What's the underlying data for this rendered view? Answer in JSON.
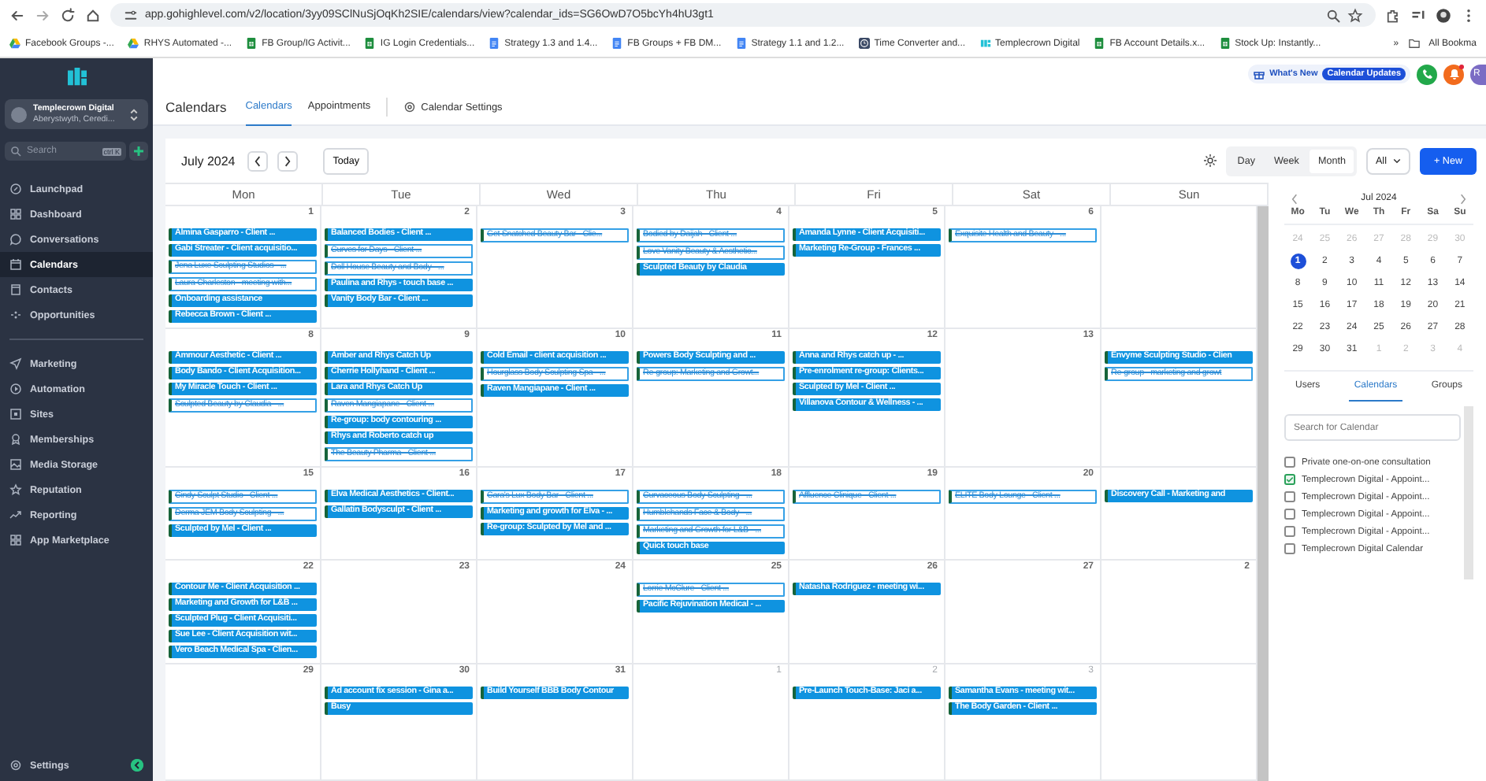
{
  "browser": {
    "url": "app.gohighlevel.com/v2/location/3yy09SClNuSjOqKh2SIE/calendars/view?calendar_ids=SG6OwD7O5bcYh4hU3gt1",
    "bookmarks": [
      {
        "label": "Facebook Groups -...",
        "kind": "drive"
      },
      {
        "label": "RHYS Automated -...",
        "kind": "drive"
      },
      {
        "label": "FB Group/IG Activit...",
        "kind": "sheets"
      },
      {
        "label": "IG Login Credentials...",
        "kind": "sheets"
      },
      {
        "label": "Strategy 1.3 and 1.4...",
        "kind": "docs"
      },
      {
        "label": "FB Groups + FB DM...",
        "kind": "docs"
      },
      {
        "label": "Strategy 1.1 and 1.2...",
        "kind": "docs"
      },
      {
        "label": "Time Converter and...",
        "kind": "clock"
      },
      {
        "label": "Templecrown Digital",
        "kind": "brand"
      },
      {
        "label": "FB Account Details.x...",
        "kind": "sheets"
      },
      {
        "label": "Stock Up: Instantly...",
        "kind": "sheets"
      }
    ],
    "more": "»",
    "all_bookmarks": "All Bookma"
  },
  "sidebar": {
    "account": {
      "name": "Templecrown Digital",
      "location": "Aberystwyth, Ceredi..."
    },
    "search": {
      "placeholder": "Search",
      "shortcut": "ctrl K"
    },
    "groups": [
      [
        {
          "label": "Launchpad",
          "selected": false
        },
        {
          "label": "Dashboard",
          "selected": false
        },
        {
          "label": "Conversations",
          "selected": false
        },
        {
          "label": "Calendars",
          "selected": true
        },
        {
          "label": "Contacts",
          "selected": false
        },
        {
          "label": "Opportunities",
          "selected": false
        }
      ],
      [
        {
          "label": "Marketing",
          "selected": false
        },
        {
          "label": "Automation",
          "selected": false
        },
        {
          "label": "Sites",
          "selected": false
        },
        {
          "label": "Memberships",
          "selected": false
        },
        {
          "label": "Media Storage",
          "selected": false
        },
        {
          "label": "Reputation",
          "selected": false
        },
        {
          "label": "Reporting",
          "selected": false
        },
        {
          "label": "App Marketplace",
          "selected": false
        }
      ]
    ],
    "settings": "Settings"
  },
  "topbar": {
    "whats_new": "What's New",
    "badge": "Calendar Updates",
    "avatar": "R"
  },
  "header": {
    "title": "Calendars",
    "tabs": [
      {
        "label": "Calendars",
        "selected": true
      },
      {
        "label": "Appointments",
        "selected": false
      }
    ],
    "settings": "Calendar Settings"
  },
  "toolbar": {
    "month": "July 2024",
    "today": "Today",
    "views": [
      {
        "label": "Day",
        "selected": false
      },
      {
        "label": "Week",
        "selected": false
      },
      {
        "label": "Month",
        "selected": true
      }
    ],
    "filter": "All",
    "new": "+ New"
  },
  "weekdays": [
    "Mon",
    "Tue",
    "Wed",
    "Thu",
    "Fri",
    "Sat",
    "Sun"
  ],
  "weeks": [
    {
      "days": [
        {
          "number": "1",
          "other_month": false,
          "events": [
            {
              "title": "Almina Gasparro - Client ...",
              "cancelled": false
            },
            {
              "title": "Gabi Streater - Client acquisitio...",
              "cancelled": false
            },
            {
              "title": "Jena Luxe Sculpting Studios - ...",
              "cancelled": true
            },
            {
              "title": "Laura Charleston - meeting with...",
              "cancelled": true
            },
            {
              "title": "Onboarding assistance",
              "cancelled": false
            },
            {
              "title": "Rebecca Brown - Client ...",
              "cancelled": false
            }
          ]
        },
        {
          "number": "2",
          "other_month": false,
          "events": [
            {
              "title": "Balanced Bodies - Client ...",
              "cancelled": false
            },
            {
              "title": "Curves for Days - Client ...",
              "cancelled": true
            },
            {
              "title": "Doll House Beauty and Body - ...",
              "cancelled": true
            },
            {
              "title": "Paulina and Rhys - touch base ...",
              "cancelled": false
            },
            {
              "title": "Vanity Body Bar - Client ...",
              "cancelled": false
            }
          ]
        },
        {
          "number": "3",
          "other_month": false,
          "events": [
            {
              "title": "Get Snatched Beauty Bar - Clie...",
              "cancelled": true
            }
          ]
        },
        {
          "number": "4",
          "other_month": false,
          "events": [
            {
              "title": "Bodied by Daijah - Client ...",
              "cancelled": true
            },
            {
              "title": "Love Vanity Beauty & Aesthetic...",
              "cancelled": true
            },
            {
              "title": "Sculpted Beauty  by Claudia",
              "cancelled": false
            }
          ]
        },
        {
          "number": "5",
          "other_month": false,
          "events": [
            {
              "title": "Amanda Lynne - Client Acquisiti...",
              "cancelled": false
            },
            {
              "title": "Marketing Re-Group - Frances ...",
              "cancelled": false
            }
          ]
        },
        {
          "number": "6",
          "other_month": false,
          "events": [
            {
              "title": "Exquisite Health and Beauty - ...",
              "cancelled": true
            }
          ]
        }
      ]
    },
    {
      "days": [
        {
          "number": "8",
          "other_month": false,
          "events": [
            {
              "title": "Ammour Aesthetic - Client ...",
              "cancelled": false
            },
            {
              "title": "Body Bando - Client Acquisition...",
              "cancelled": false
            },
            {
              "title": "My Miracle Touch - Client ...",
              "cancelled": false
            },
            {
              "title": "Sculpted Beauty by Claudia - ...",
              "cancelled": true
            }
          ]
        },
        {
          "number": "9",
          "other_month": false,
          "events": [
            {
              "title": "Amber and Rhys Catch Up",
              "cancelled": false
            },
            {
              "title": "Cherrie Hollyhand - Client ...",
              "cancelled": false
            },
            {
              "title": "Lara and Rhys Catch Up",
              "cancelled": false
            },
            {
              "title": "Raven Mangiapane - Client ...",
              "cancelled": true
            },
            {
              "title": "Re-group: body contouring ...",
              "cancelled": false
            },
            {
              "title": "Rhys and Roberto catch up",
              "cancelled": false
            },
            {
              "title": "The Beauty Pharma - Client ...",
              "cancelled": true
            }
          ]
        },
        {
          "number": "10",
          "other_month": false,
          "events": [
            {
              "title": "Cold Email - client acquisition ...",
              "cancelled": false
            },
            {
              "title": "Hourglass Body Sculpting Spa - ...",
              "cancelled": true
            },
            {
              "title": "Raven Mangiapane - Client ...",
              "cancelled": false
            }
          ]
        },
        {
          "number": "11",
          "other_month": false,
          "events": [
            {
              "title": "Powers Body Sculpting and ...",
              "cancelled": false
            },
            {
              "title": "Re-group: Marketing and Growt...",
              "cancelled": true
            }
          ]
        },
        {
          "number": "12",
          "other_month": false,
          "events": [
            {
              "title": "Anna and Rhys catch up - ...",
              "cancelled": false
            },
            {
              "title": "Pre-enrolment re-group: Clients...",
              "cancelled": false
            },
            {
              "title": "Sculpted by Mel - Client ...",
              "cancelled": false
            },
            {
              "title": "Villanova Contour & Wellness - ...",
              "cancelled": false
            }
          ]
        },
        {
          "number": "13",
          "other_month": false
        },
        {
          "events": [
            {
              "title": "Envyme Sculpting Studio - Clien",
              "cancelled": false
            },
            {
              "title": "Re-group - marketing and growt",
              "cancelled": true
            }
          ]
        }
      ]
    },
    {
      "days": [
        {
          "number": "15",
          "other_month": false,
          "events": [
            {
              "title": "Cindy Sculpt Studio - Client ...",
              "cancelled": true
            },
            {
              "title": "Derma JEM Body Sculpting - ...",
              "cancelled": true
            },
            {
              "title": "Sculpted by Mel - Client ...",
              "cancelled": false
            }
          ]
        },
        {
          "number": "16",
          "other_month": false,
          "events": [
            {
              "title": "Elva Medical Aesthetics - Client...",
              "cancelled": false
            },
            {
              "title": "Gallatin Bodysculpt - Client ...",
              "cancelled": false
            }
          ]
        },
        {
          "number": "17",
          "other_month": false,
          "events": [
            {
              "title": "Cara's Lux Body Bar - Client ...",
              "cancelled": true
            },
            {
              "title": "Marketing and growth for Elva - ...",
              "cancelled": false
            },
            {
              "title": "Re-group: Sculpted by Mel and ...",
              "cancelled": false
            }
          ]
        },
        {
          "number": "18",
          "other_month": false,
          "events": [
            {
              "title": "Curvaceous Body Sculpting - ...",
              "cancelled": true
            },
            {
              "title": "Humblehands Face & Body - ...",
              "cancelled": true
            },
            {
              "title": "Marketing and Growth for L&B - ...",
              "cancelled": true
            },
            {
              "title": "Quick touch base",
              "cancelled": false
            }
          ]
        },
        {
          "number": "19",
          "other_month": false,
          "events": [
            {
              "title": "Affluence Clinique - Client ...",
              "cancelled": true
            }
          ]
        },
        {
          "number": "20",
          "other_month": false,
          "events": [
            {
              "title": "ELITE Body Lounge - Client ...",
              "cancelled": true
            }
          ]
        },
        {
          "events": [
            {
              "title": "Discovery Call - Marketing and",
              "cancelled": false
            }
          ]
        }
      ]
    },
    {
      "days": [
        {
          "number": "22",
          "other_month": false,
          "events": [
            {
              "title": "Contour Me - Client Acquisition ...",
              "cancelled": false
            },
            {
              "title": "Marketing and Growth for L&B ...",
              "cancelled": false
            },
            {
              "title": "Sculpted Plug - Client Acquisiti...",
              "cancelled": false
            },
            {
              "title": "Sue Lee - Client Acquisition wit...",
              "cancelled": false
            },
            {
              "title": "Vero Beach Medical Spa - Clien...",
              "cancelled": false
            }
          ]
        },
        {
          "number": "23",
          "other_month": false
        },
        {
          "number": "24",
          "other_month": false
        },
        {
          "number": "25",
          "other_month": false,
          "events": [
            {
              "title": "Lorrie McClure - Client ...",
              "cancelled": true
            },
            {
              "title": "Pacific Rejuvination Medical  - ...",
              "cancelled": false
            }
          ]
        },
        {
          "number": "26",
          "other_month": false,
          "events": [
            {
              "title": "Natasha Rodriguez - meeting wi...",
              "cancelled": false
            }
          ]
        },
        {
          "number": "27",
          "other_month": false
        },
        {
          "number": "2",
          "other_month": false
        }
      ]
    },
    {
      "days": [
        {
          "number": "29",
          "other_month": false
        },
        {
          "number": "30",
          "other_month": false,
          "events": [
            {
              "title": "Ad account fix session - Gina a...",
              "cancelled": false
            },
            {
              "title": "Busy",
              "cancelled": false
            }
          ]
        },
        {
          "number": "31",
          "other_month": false,
          "events": [
            {
              "title": "Build Yourself BBB Body Contour",
              "cancelled": false
            }
          ]
        },
        {
          "number": "1",
          "other_month": true
        },
        {
          "number": "2",
          "other_month": true,
          "events": [
            {
              "title": "Pre-Launch Touch-Base: Jaci a...",
              "cancelled": false
            }
          ]
        },
        {
          "number": "3",
          "other_month": true,
          "events": [
            {
              "title": "Samantha  Evans  - meeting wit...",
              "cancelled": false
            },
            {
              "title": "The Body Garden - Client ...",
              "cancelled": false
            }
          ]
        }
      ]
    }
  ],
  "mini_calendar": {
    "title": "Jul 2024",
    "weekdays": [
      "Mo",
      "Tu",
      "We",
      "Th",
      "Fr",
      "Sa",
      "Su"
    ],
    "weeks": [
      [
        {
          "day": "24",
          "other_month": true,
          "selected": false
        },
        {
          "day": "25",
          "other_month": true,
          "selected": false
        },
        {
          "day": "26",
          "other_month": true,
          "selected": false
        },
        {
          "day": "27",
          "other_month": true,
          "selected": false
        },
        {
          "day": "28",
          "other_month": true,
          "selected": false
        },
        {
          "day": "29",
          "other_month": true,
          "selected": false
        },
        {
          "day": "30",
          "other_month": true,
          "selected": false
        }
      ],
      [
        {
          "day": "1",
          "other_month": false,
          "selected": true
        },
        {
          "day": "2",
          "other_month": false,
          "selected": false
        },
        {
          "day": "3",
          "other_month": false,
          "selected": false
        },
        {
          "day": "4",
          "other_month": false,
          "selected": false
        },
        {
          "day": "5",
          "other_month": false,
          "selected": false
        },
        {
          "day": "6",
          "other_month": false,
          "selected": false
        },
        {
          "day": "7",
          "other_month": false,
          "selected": false
        }
      ],
      [
        {
          "day": "8",
          "other_month": false,
          "selected": false
        },
        {
          "day": "9",
          "other_month": false,
          "selected": false
        },
        {
          "day": "10",
          "other_month": false,
          "selected": false
        },
        {
          "day": "11",
          "other_month": false,
          "selected": false
        },
        {
          "day": "12",
          "other_month": false,
          "selected": false
        },
        {
          "day": "13",
          "other_month": false,
          "selected": false
        },
        {
          "day": "14",
          "other_month": false,
          "selected": false
        }
      ],
      [
        {
          "day": "15",
          "other_month": false,
          "selected": false
        },
        {
          "day": "16",
          "other_month": false,
          "selected": false
        },
        {
          "day": "17",
          "other_month": false,
          "selected": false
        },
        {
          "day": "18",
          "other_month": false,
          "selected": false
        },
        {
          "day": "19",
          "other_month": false,
          "selected": false
        },
        {
          "day": "20",
          "other_month": false,
          "selected": false
        },
        {
          "day": "21",
          "other_month": false,
          "selected": false
        }
      ],
      [
        {
          "day": "22",
          "other_month": false,
          "selected": false
        },
        {
          "day": "23",
          "other_month": false,
          "selected": false
        },
        {
          "day": "24",
          "other_month": false,
          "selected": false
        },
        {
          "day": "25",
          "other_month": false,
          "selected": false
        },
        {
          "day": "26",
          "other_month": false,
          "selected": false
        },
        {
          "day": "27",
          "other_month": false,
          "selected": false
        },
        {
          "day": "28",
          "other_month": false,
          "selected": false
        }
      ],
      [
        {
          "day": "29",
          "other_month": false,
          "selected": false
        },
        {
          "day": "30",
          "other_month": false,
          "selected": false
        },
        {
          "day": "31",
          "other_month": false,
          "selected": false
        },
        {
          "day": "1",
          "other_month": true,
          "selected": false
        },
        {
          "day": "2",
          "other_month": true,
          "selected": false
        },
        {
          "day": "3",
          "other_month": true,
          "selected": false
        },
        {
          "day": "4",
          "other_month": true,
          "selected": false
        }
      ]
    ]
  },
  "panel_tabs": [
    {
      "label": "Users",
      "selected": false
    },
    {
      "label": "Calendars",
      "selected": true
    },
    {
      "label": "Groups",
      "selected": false
    }
  ],
  "calendar_search": {
    "placeholder": "Search for Calendar"
  },
  "calendar_list": [
    {
      "label": "Private one-on-one consultation",
      "checked": false
    },
    {
      "label": "Templecrown Digital - Appoint...",
      "checked": true
    },
    {
      "label": "Templecrown Digital - Appoint...",
      "checked": false
    },
    {
      "label": "Templecrown Digital - Appoint...",
      "checked": false
    },
    {
      "label": "Templecrown Digital - Appoint...",
      "checked": false
    },
    {
      "label": "Templecrown Digital Calendar",
      "checked": false
    }
  ]
}
